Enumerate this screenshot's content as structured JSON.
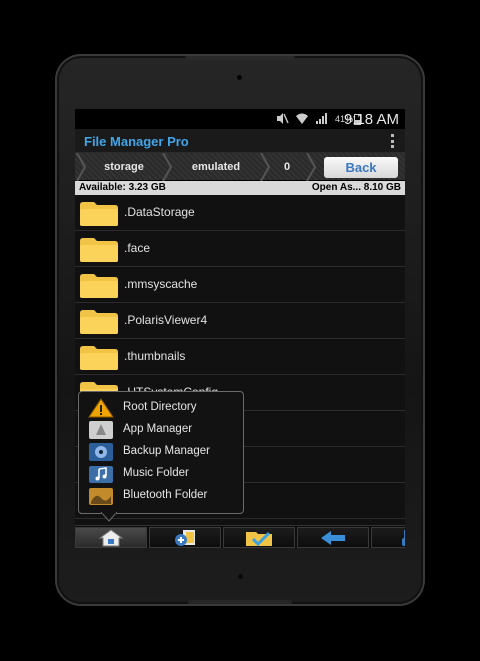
{
  "status": {
    "battery": "41%",
    "time": "9:18 AM"
  },
  "app": {
    "title": "File Manager Pro"
  },
  "breadcrumb": {
    "items": [
      "storage",
      "emulated",
      "0"
    ],
    "back_label": "Back"
  },
  "storage": {
    "available": "Available: 3.23 GB",
    "open": "Open As... 8.10 GB"
  },
  "files": [
    ".DataStorage",
    ".face",
    ".mmsyscache",
    ".PolarisViewer4",
    ".thumbnails",
    ".UTSystemConfig"
  ],
  "popup": {
    "items": [
      "Root Directory",
      "App Manager",
      "Backup Manager",
      "Music Folder",
      "Bluetooth Folder"
    ]
  },
  "colors": {
    "accent": "#42a5e8",
    "folder": "#f5c84a",
    "back_text": "#3a78c2"
  }
}
